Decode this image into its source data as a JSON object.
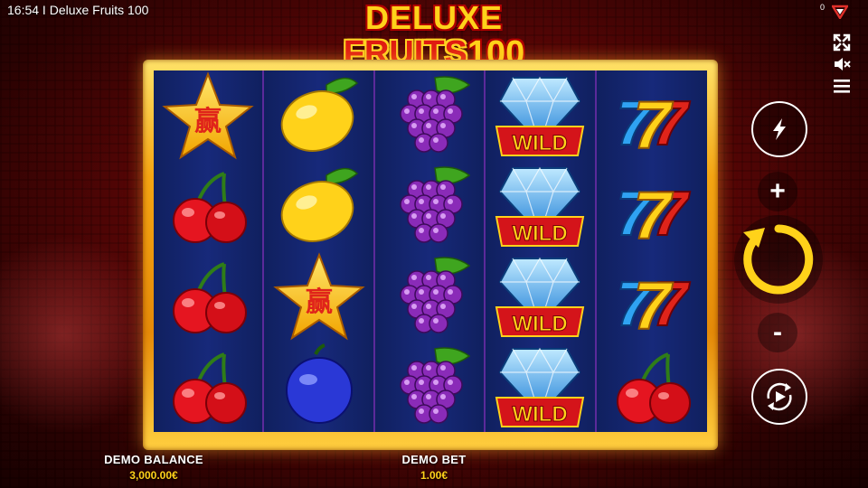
{
  "window": {
    "title": "16:54 I Deluxe Fruits 100",
    "counter": "0"
  },
  "logo": {
    "line1": "DELUXE",
    "line2_word": "FRUITS",
    "line2_num": "100"
  },
  "reels": [
    [
      "star-symbol",
      "cherry-symbol",
      "cherry-symbol",
      "cherry-symbol"
    ],
    [
      "lemon-symbol",
      "lemon-symbol",
      "star-symbol",
      "plum-symbol"
    ],
    [
      "grapes-symbol",
      "grapes-symbol",
      "grapes-symbol",
      "grapes-symbol"
    ],
    [
      "diamond-wild-symbol",
      "diamond-wild-symbol",
      "diamond-wild-symbol",
      "diamond-wild-symbol"
    ],
    [
      "seven-symbol",
      "seven-symbol",
      "seven-symbol",
      "cherry-symbol"
    ]
  ],
  "symbol_text": {
    "star": "赢",
    "wild": "WILD"
  },
  "balance": {
    "label": "DEMO BALANCE",
    "value": "3,000.00€"
  },
  "bet": {
    "label": "DEMO BET",
    "value": "1.00€"
  },
  "controls": {
    "plus": "+",
    "minus": "-"
  },
  "icons": {
    "turbo": "lightning-icon",
    "spin": "spin-arrow-icon",
    "autoplay": "autoplay-icon",
    "fullscreen": "fullscreen-icon",
    "sound": "sound-muted-icon",
    "menu": "menu-icon",
    "brand": "brand-logo-icon"
  },
  "colors": {
    "accent": "#ffd21a",
    "reel_bg": "#17297a",
    "frame": "#f4a512"
  }
}
